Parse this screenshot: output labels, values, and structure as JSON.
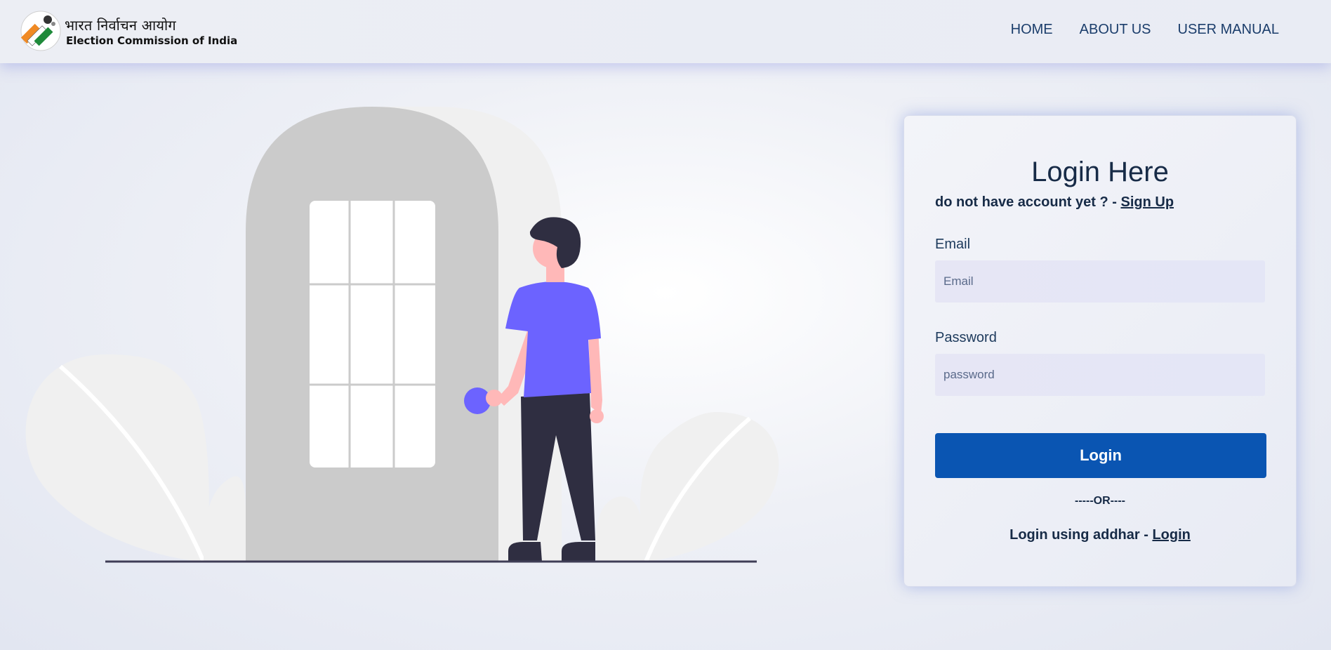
{
  "header": {
    "logo_hindi": "भारत निर्वाचन आयोग",
    "logo_english": "Election Commission of India",
    "nav": [
      {
        "label": "HOME"
      },
      {
        "label": "ABOUT US"
      },
      {
        "label": "USER MANUAL"
      }
    ]
  },
  "login": {
    "title": "Login Here",
    "signup_prompt": "do not have account yet ? - ",
    "signup_link": "Sign Up",
    "email_label": "Email",
    "email_placeholder": "Email",
    "password_label": "Password",
    "password_placeholder": "password",
    "login_button": "Login",
    "or_divider": "-----OR----",
    "addhar_prompt": "Login using addhar - ",
    "addhar_link": "Login"
  },
  "colors": {
    "primary_button": "#0a55b2",
    "nav_text": "#1b3d6b",
    "illustration_accent": "#6c63ff"
  }
}
